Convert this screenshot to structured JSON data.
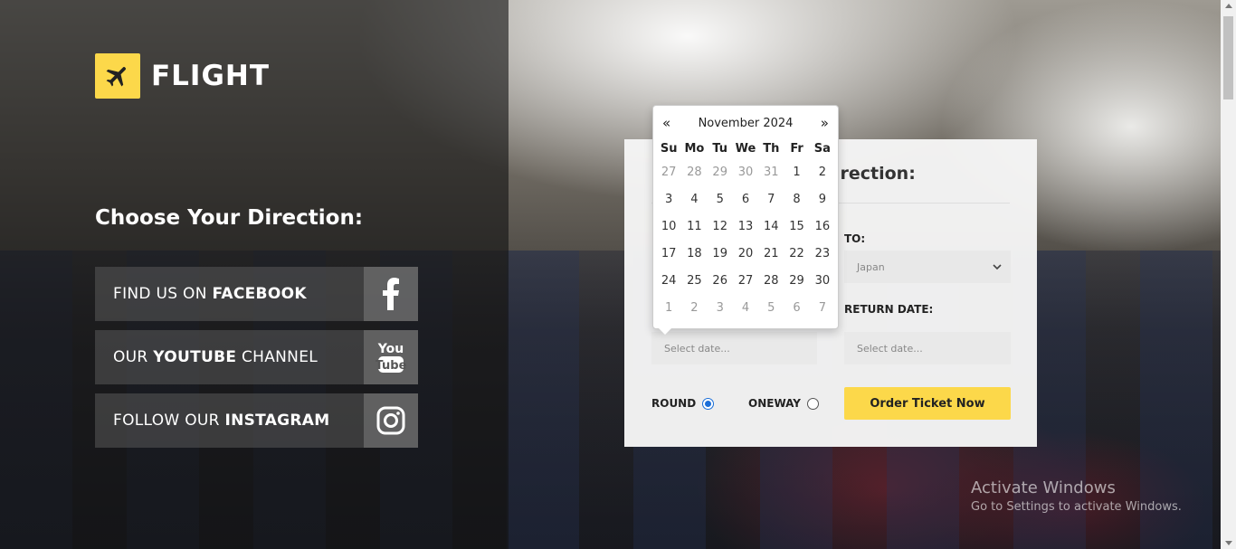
{
  "brand": {
    "name": "FLIGHT",
    "icon": "airplane-icon",
    "accent": "#fcd84a"
  },
  "left": {
    "title": "Choose Your Direction:",
    "social": [
      {
        "prefix": "FIND US ON ",
        "bold": "FACEBOOK",
        "suffix": "",
        "icon": "facebook-icon"
      },
      {
        "prefix": "OUR ",
        "bold": "YOUTUBE",
        "suffix": " CHANNEL",
        "icon": "youtube-icon"
      },
      {
        "prefix": "FOLLOW OUR ",
        "bold": "INSTAGRAM",
        "suffix": "",
        "icon": "instagram-icon"
      }
    ]
  },
  "form": {
    "title_visible": "irection:",
    "to_label": "TO:",
    "to_value": "Japan",
    "return_label": "RETURN DATE:",
    "depart_placeholder": "Select date...",
    "return_placeholder": "Select date...",
    "round_label": "ROUND",
    "oneway_label": "ONEWAY",
    "trip_type_selected": "ROUND",
    "order_button": "Order Ticket Now"
  },
  "datepicker": {
    "prev": "«",
    "next": "»",
    "month_label": "November 2024",
    "weekdays": [
      "Su",
      "Mo",
      "Tu",
      "We",
      "Th",
      "Fr",
      "Sa"
    ],
    "weeks": [
      [
        {
          "d": "27",
          "m": true
        },
        {
          "d": "28",
          "m": true
        },
        {
          "d": "29",
          "m": true
        },
        {
          "d": "30",
          "m": true
        },
        {
          "d": "31",
          "m": true
        },
        {
          "d": "1"
        },
        {
          "d": "2"
        }
      ],
      [
        {
          "d": "3"
        },
        {
          "d": "4"
        },
        {
          "d": "5"
        },
        {
          "d": "6"
        },
        {
          "d": "7"
        },
        {
          "d": "8"
        },
        {
          "d": "9"
        }
      ],
      [
        {
          "d": "10"
        },
        {
          "d": "11"
        },
        {
          "d": "12"
        },
        {
          "d": "13"
        },
        {
          "d": "14"
        },
        {
          "d": "15"
        },
        {
          "d": "16"
        }
      ],
      [
        {
          "d": "17"
        },
        {
          "d": "18"
        },
        {
          "d": "19"
        },
        {
          "d": "20"
        },
        {
          "d": "21"
        },
        {
          "d": "22"
        },
        {
          "d": "23"
        }
      ],
      [
        {
          "d": "24"
        },
        {
          "d": "25"
        },
        {
          "d": "26"
        },
        {
          "d": "27"
        },
        {
          "d": "28"
        },
        {
          "d": "29"
        },
        {
          "d": "30"
        }
      ],
      [
        {
          "d": "1",
          "m": true
        },
        {
          "d": "2",
          "m": true
        },
        {
          "d": "3",
          "m": true
        },
        {
          "d": "4",
          "m": true
        },
        {
          "d": "5",
          "m": true
        },
        {
          "d": "6",
          "m": true
        },
        {
          "d": "7",
          "m": true
        }
      ]
    ]
  },
  "watermark": {
    "line1": "Activate Windows",
    "line2": "Go to Settings to activate Windows."
  }
}
